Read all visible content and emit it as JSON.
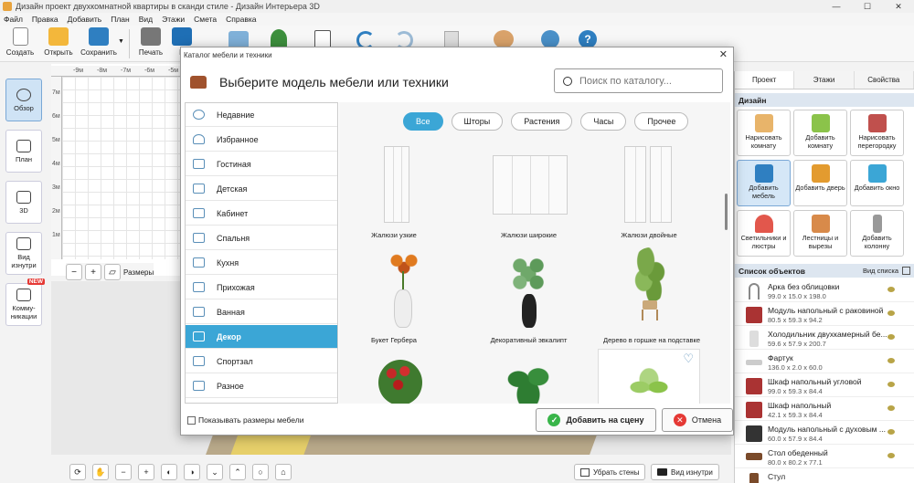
{
  "window": {
    "title": "Дизайн проект двухкомнатной квартиры в сканди стиле - Дизайн Интерьера 3D",
    "minimize": "—",
    "maximize": "☐",
    "close": "✕"
  },
  "menu": [
    "Файл",
    "Правка",
    "Добавить",
    "План",
    "Вид",
    "Этажи",
    "Смета",
    "Справка"
  ],
  "toolbar": {
    "create": "Создать",
    "open": "Открыть",
    "save": "Сохранить",
    "print": "Печать",
    "plan_prefix": "П"
  },
  "left_panel": {
    "overview": "Обзор",
    "plan": "План",
    "view3d": "3D",
    "interior_view": "Вид изнутри",
    "communications": "Комму-никации",
    "new_badge": "NEW"
  },
  "ruler": {
    "h": [
      "-9м",
      "-8м",
      "-7м",
      "-6м",
      "-5м"
    ],
    "v": [
      "7м",
      "6м",
      "5м",
      "4м",
      "3м",
      "2м",
      "1м"
    ]
  },
  "zoom_bar": {
    "sizes_label": "Размеры"
  },
  "bottom_bar": {
    "remove_walls": "Убрать стены",
    "interior_view": "Вид изнутри"
  },
  "right_panel": {
    "tabs": [
      "Проект",
      "Этажи",
      "Свойства"
    ],
    "design_title": "Дизайн",
    "design_items": [
      "Нарисовать комнату",
      "Добавить комнату",
      "Нарисовать перегородку",
      "Добавить мебель",
      "Добавить дверь",
      "Добавить окно",
      "Светильники и люстры",
      "Лестницы и вырезы",
      "Добавить колонну"
    ],
    "objects_title": "Список объектов",
    "objects_view": "Вид списка",
    "objects": [
      {
        "name": "Арка без облицовки",
        "dims": "99.0 x 15.0 x 198.0"
      },
      {
        "name": "Модуль напольный с раковиной",
        "dims": "80.5 x 59.3 x 94.2"
      },
      {
        "name": "Холодильник двухкамерный бе...",
        "dims": "59.6 x 57.9 x 200.7"
      },
      {
        "name": "Фартук",
        "dims": "136.0 x 2.0 x 60.0"
      },
      {
        "name": "Шкаф напольный угловой",
        "dims": "99.0 x 59.3 x 84.4"
      },
      {
        "name": "Шкаф напольный",
        "dims": "42.1 x 59.3 x 84.4"
      },
      {
        "name": "Модуль напольный с духовым ...",
        "dims": "60.0 x 57.9 x 84.4"
      },
      {
        "name": "Стол обеденный",
        "dims": "80.0 x 80.2 x 77.1"
      },
      {
        "name": "Стул",
        "dims": ""
      }
    ]
  },
  "dialog": {
    "title": "Каталог мебели и техники",
    "close": "✕",
    "heading": "Выберите модель мебели или техники",
    "search_placeholder": "Поиск по каталогу...",
    "categories": [
      "Недавние",
      "Избранное",
      "Гостиная",
      "Детская",
      "Кабинет",
      "Спальня",
      "Кухня",
      "Прихожая",
      "Ванная",
      "Декор",
      "Спортзал",
      "Разное"
    ],
    "active_category": "Декор",
    "filters": [
      "Все",
      "Шторы",
      "Растения",
      "Часы",
      "Прочее"
    ],
    "items": [
      "Жалюзи узкие",
      "Жалюзи широкие",
      "Жалюзи двойные",
      "Букет Гербера",
      "Декоративный эвкалипт",
      "Дерево в горшке на подставке"
    ],
    "show_sizes": "Показывать размеры мебели",
    "add_button": "Добавить на сцену",
    "cancel_button": "Отмена"
  }
}
